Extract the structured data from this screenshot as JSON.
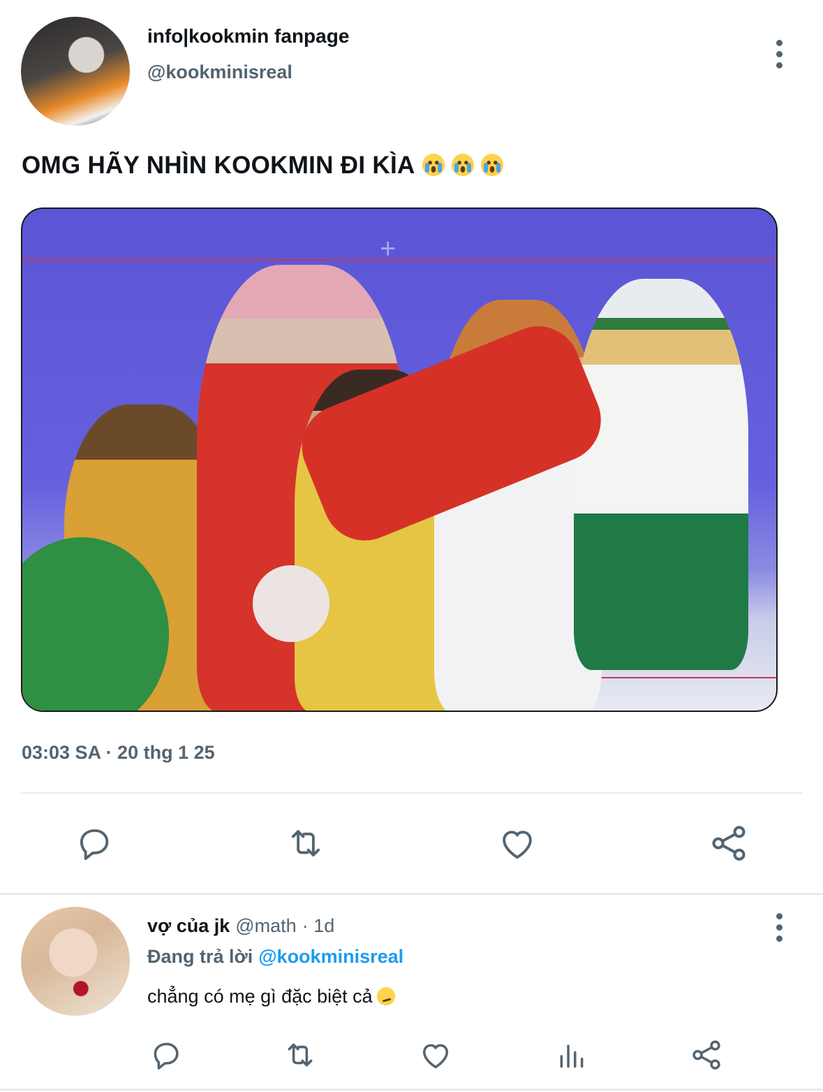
{
  "tweet": {
    "display_name": "info|kookmin fanpage",
    "handle": "@kookminisreal",
    "text": "OMG HÃY NHÌN KOOKMIN ĐI KÌA",
    "emoji": [
      "loudly-crying-face",
      "loudly-crying-face",
      "loudly-crying-face"
    ],
    "timestamp": "03:03 SA · 20 thg 1 25",
    "actions": [
      "reply-icon",
      "retweet-icon",
      "like-icon",
      "share-icon"
    ]
  },
  "reply": {
    "display_name": "vợ của jk",
    "handle": "@math",
    "age": "· 1d",
    "replying_label": "Đang trả lời",
    "replying_to": "@kookminisreal",
    "text": "chẳng có mẹ gì đặc biệt cả",
    "emoji": "smirking-face",
    "actions": [
      "reply-icon",
      "retweet-icon",
      "like-icon",
      "views-icon",
      "share-icon"
    ]
  },
  "colors": {
    "text": "#0f1419",
    "secondary": "#536471",
    "link": "#1d9bf0",
    "divider": "#e7e9ea"
  }
}
